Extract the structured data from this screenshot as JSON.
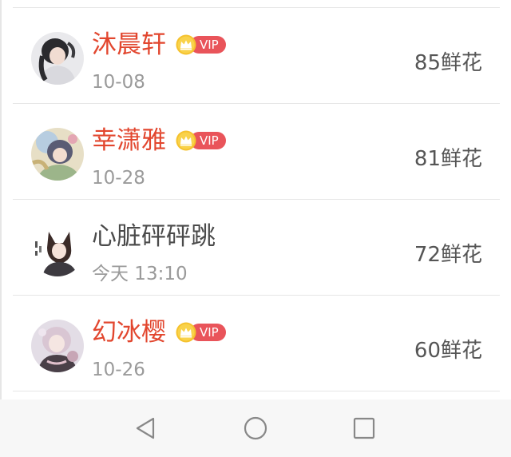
{
  "rows": [
    {
      "name": "沐晨轩",
      "vip": true,
      "date": "10-08",
      "flowers": "85鲜花"
    },
    {
      "name": "幸潇雅",
      "vip": true,
      "date": "10-28",
      "flowers": "81鲜花"
    },
    {
      "name": "心脏砰砰跳",
      "vip": false,
      "date": "今天 13:10",
      "flowers": "72鲜花"
    },
    {
      "name": "幻冰樱",
      "vip": true,
      "date": "10-26",
      "flowers": "60鲜花"
    }
  ],
  "vip_badge": {
    "label": "VIP",
    "crown_icon": "crown-icon"
  },
  "colors": {
    "vip_name": "#e2462e",
    "plain_name": "#4a4a4a",
    "vip_pill": "#e9545a",
    "crown": "#f5c22e",
    "date": "#9a9a9a",
    "flowers": "#555555",
    "divider": "#e6e6e6",
    "navbar_bg": "#f7f7f7"
  },
  "navbar": {
    "back_icon": "triangle-back-icon",
    "home_icon": "circle-home-icon",
    "recents_icon": "square-recents-icon"
  }
}
